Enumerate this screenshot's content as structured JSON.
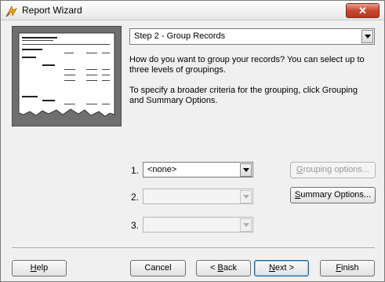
{
  "window": {
    "title": "Report Wizard",
    "close_glyph": "✕"
  },
  "step_select": {
    "value": "Step 2 - Group Records"
  },
  "description": {
    "line1": "How do you want to group your records? You can select up to three levels of groupings.",
    "line2": "To specify a broader criteria for the grouping, click Grouping and Summary Options."
  },
  "groupings": [
    {
      "number": "1.",
      "value": "<none>",
      "enabled": true
    },
    {
      "number": "2.",
      "value": "",
      "enabled": false
    },
    {
      "number": "3.",
      "value": "",
      "enabled": false
    }
  ],
  "buttons": {
    "grouping_options": {
      "mnemonic": "G",
      "rest": "rouping options...",
      "enabled": false
    },
    "summary_options": {
      "mnemonic": "S",
      "rest": "ummary Options...",
      "enabled": true
    },
    "help": {
      "mnemonic": "H",
      "rest": "elp"
    },
    "cancel": {
      "label": "Cancel"
    },
    "back": {
      "prefix": "< ",
      "mnemonic": "B",
      "rest": "ack"
    },
    "next": {
      "mnemonic": "N",
      "rest": "ext >"
    },
    "finish": {
      "mnemonic": "F",
      "rest": "inish"
    }
  },
  "icons": {
    "app": "report-wizard-icon",
    "dropdown": "chevron-down-icon",
    "preview": "report-preview-illustration"
  }
}
